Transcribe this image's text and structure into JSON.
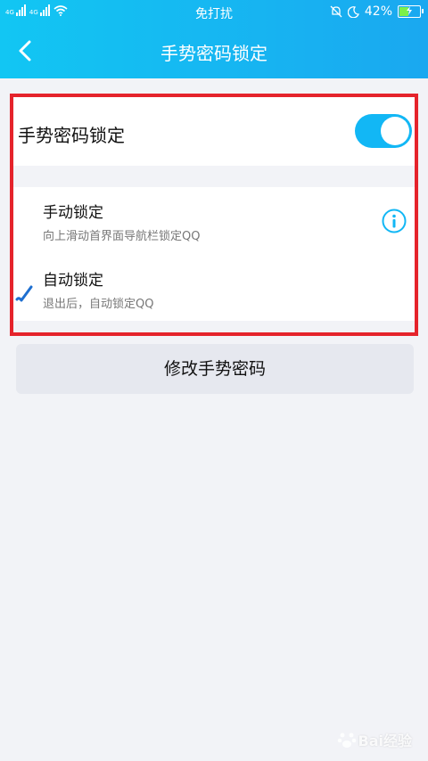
{
  "status_bar": {
    "network_1": "4G",
    "network_2": "4G",
    "center_text": "免打扰",
    "battery": "42%",
    "battery_level": 0.42
  },
  "header": {
    "title": "手势密码锁定"
  },
  "gesture_lock": {
    "label": "手势密码锁定",
    "enabled": true
  },
  "lock_options": [
    {
      "title": "手动锁定",
      "subtitle": "向上滑动首界面导航栏锁定QQ",
      "selected": false
    },
    {
      "title": "自动锁定",
      "subtitle": "退出后，自动锁定QQ",
      "selected": true
    }
  ],
  "modify_button": {
    "label": "修改手势密码"
  },
  "colors": {
    "accent": "#12b7f5",
    "highlight_border": "#e5232b"
  },
  "icons": {
    "back": "chevron-left-icon",
    "info": "info-circle-icon",
    "check": "check-icon"
  },
  "watermark": {
    "text": "Bai经验"
  }
}
